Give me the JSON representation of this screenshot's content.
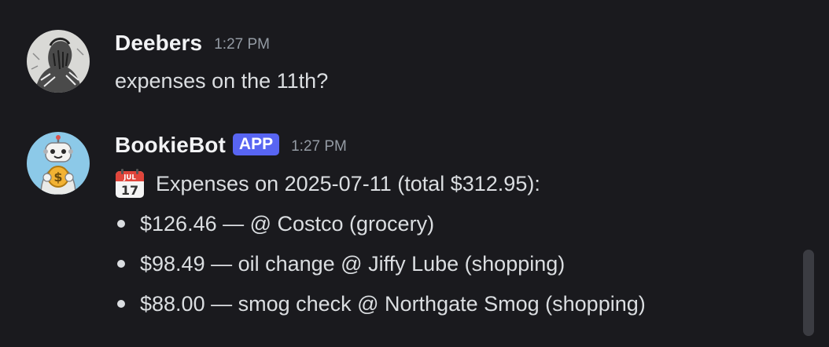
{
  "messages": [
    {
      "author": "Deebers",
      "timestamp": "1:27 PM",
      "text": "expenses on the 11th?",
      "avatar_icon": "sketch-portrait-avatar"
    },
    {
      "author": "BookieBot",
      "badge": "APP",
      "timestamp": "1:27 PM",
      "avatar_icon": "robot-with-coin-avatar",
      "calendar_icon": {
        "name": "calendar-icon",
        "month": "JUL",
        "day": "17"
      },
      "summary": "Expenses on 2025-07-11 (total $312.95):",
      "items": [
        {
          "text": "$126.46 —  @ Costco (grocery)"
        },
        {
          "text": "$98.49 — oil change @ Jiffy Lube (shopping)"
        },
        {
          "text": "$88.00 — smog check @ Northgate Smog (shopping)"
        }
      ]
    }
  ],
  "colors": {
    "background": "#1a1a1e",
    "username": "#f2f3f5",
    "message_text": "#dbdee1",
    "timestamp": "#949ba4",
    "app_badge": "#5865f2",
    "bot_avatar_bg": "#8cc9e8",
    "coin": "#f2b233"
  }
}
